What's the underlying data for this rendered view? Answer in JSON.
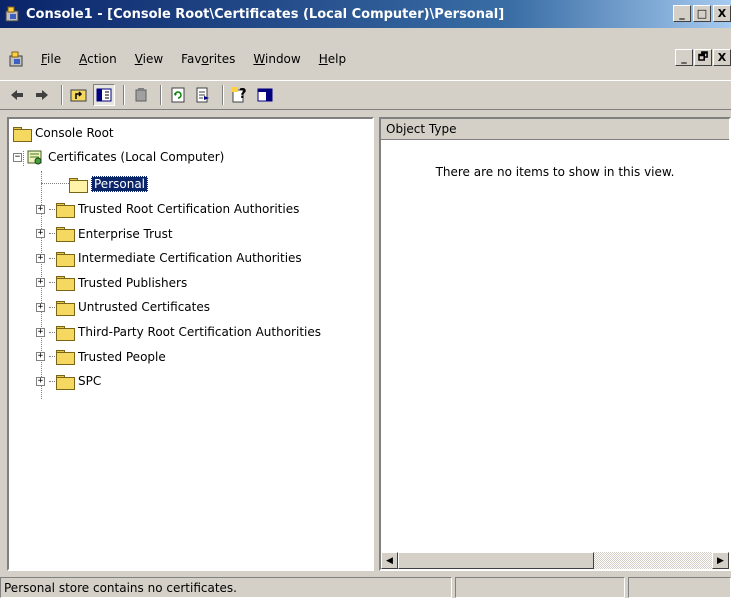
{
  "window": {
    "title": "Console1 - [Console Root\\Certificates (Local Computer)\\Personal]",
    "caption_buttons": [
      "_",
      "□",
      "X"
    ],
    "mdi_buttons": [
      "_",
      "🗗",
      "X"
    ]
  },
  "menu": [
    {
      "accel": "F",
      "rest": "ile"
    },
    {
      "accel": "A",
      "rest": "ction"
    },
    {
      "accel": "V",
      "rest": "iew"
    },
    {
      "pre": "Fav",
      "accel": "o",
      "rest": "rites"
    },
    {
      "accel": "W",
      "rest": "indow"
    },
    {
      "accel": "H",
      "rest": "elp"
    }
  ],
  "toolbar": {
    "icons": [
      "back-icon",
      "forward-icon",
      "up-level-icon",
      "show-tree-icon",
      "delete-icon",
      "refresh-icon",
      "export-list-icon",
      "help-icon",
      "show-hide-action-pane-icon"
    ]
  },
  "tree": {
    "root": "Console Root",
    "certificates": "Certificates (Local Computer)",
    "selected": "Personal",
    "items": [
      "Trusted Root Certification Authorities",
      "Enterprise Trust",
      "Intermediate Certification Authorities",
      "Trusted Publishers",
      "Untrusted Certificates",
      "Third-Party Root Certification Authorities",
      "Trusted People",
      "SPC"
    ]
  },
  "list": {
    "column_header": "Object Type",
    "empty_message": "There are no items to show in this view."
  },
  "status": {
    "text": "Personal store contains no certificates."
  },
  "colors": {
    "titlebar_start": "#0a246a",
    "titlebar_end": "#a6caf0",
    "selection": "#0a246a",
    "face": "#d4d0c8"
  }
}
